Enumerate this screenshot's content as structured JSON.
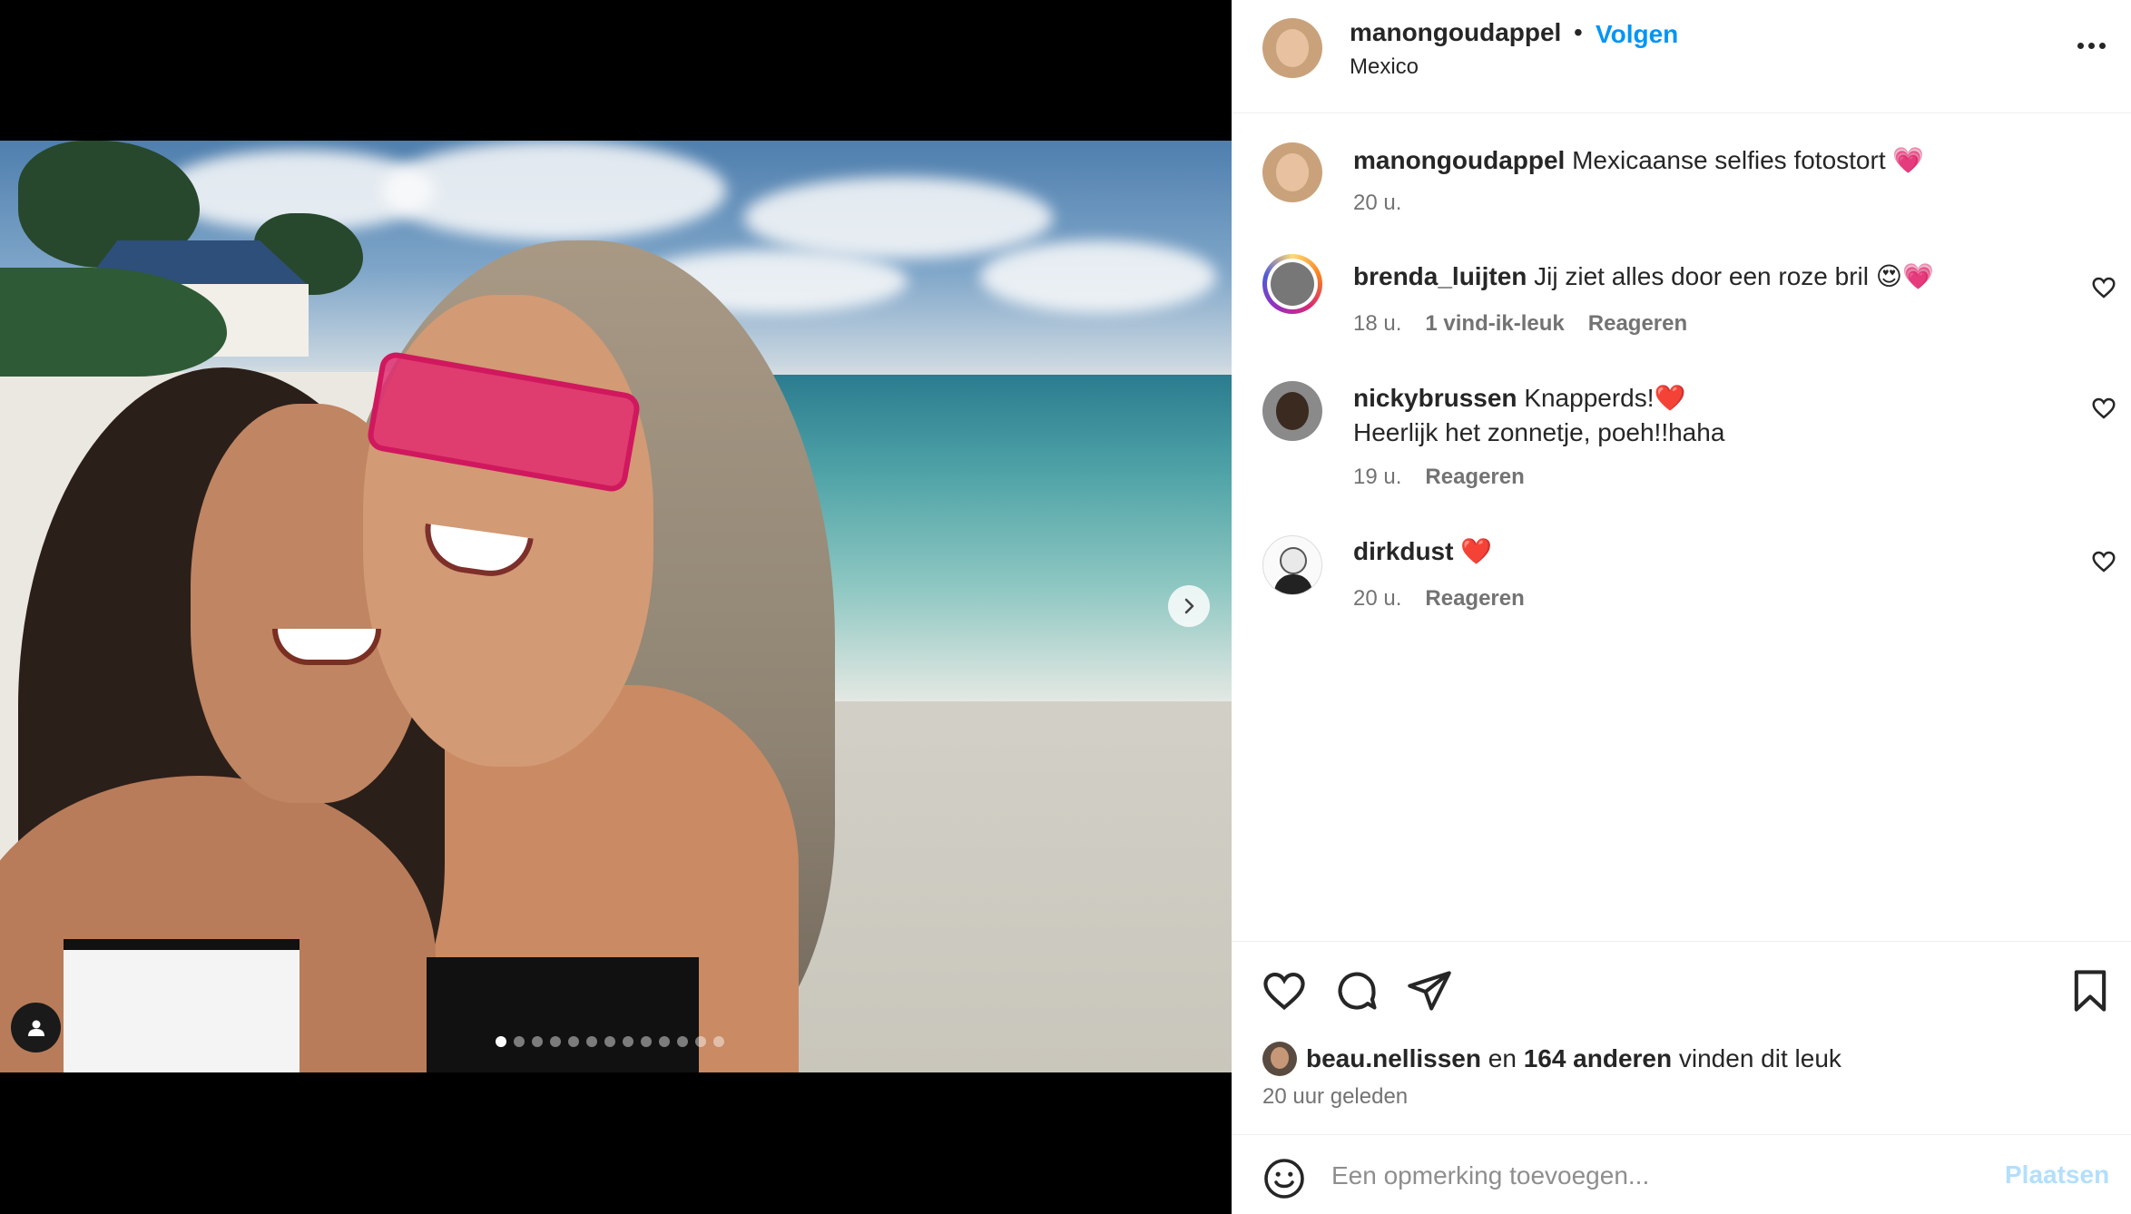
{
  "post": {
    "author": "manongoudappel",
    "separator": "•",
    "follow_label": "Volgen",
    "location": "Mexico",
    "caption_author": "manongoudappel",
    "caption_text": "Mexicaanse selfies fotostort",
    "caption_emoji": "💗",
    "caption_time": "20 u.",
    "carousel": {
      "total": 13,
      "active": 1
    }
  },
  "comments": [
    {
      "user": "brenda_luijten",
      "text": "Jij ziet alles door een roze bril",
      "emoji": "😍💗",
      "time": "18 u.",
      "likes": "1 vind-ik-leuk",
      "reply": "Reageren"
    },
    {
      "user": "nickybrussen",
      "text": "Knapperds!",
      "emoji": "❤️",
      "text2": "Heerlijk het zonnetje, poeh!!haha",
      "time": "19 u.",
      "reply": "Reageren"
    },
    {
      "user": "dirkdust",
      "text": "",
      "emoji": "❤️",
      "time": "20 u.",
      "reply": "Reageren"
    }
  ],
  "likes": {
    "user": "beau.nellissen",
    "connector": "en",
    "others": "164 anderen",
    "suffix": "vinden dit leuk",
    "time_ago": "20 uur geleden"
  },
  "comment_box": {
    "placeholder": "Een opmerking toevoegen...",
    "post_label": "Plaatsen"
  },
  "icons": {
    "more": "more-options-icon",
    "next": "chevron-right-icon",
    "tag": "user-tag-icon",
    "like": "heart-icon",
    "comment": "comment-icon",
    "share": "share-icon",
    "save": "bookmark-icon",
    "emoji": "emoji-icon"
  },
  "colors": {
    "accent": "#0095f6",
    "post_disabled": "#b2dffc",
    "story_ring": "#d62976"
  }
}
